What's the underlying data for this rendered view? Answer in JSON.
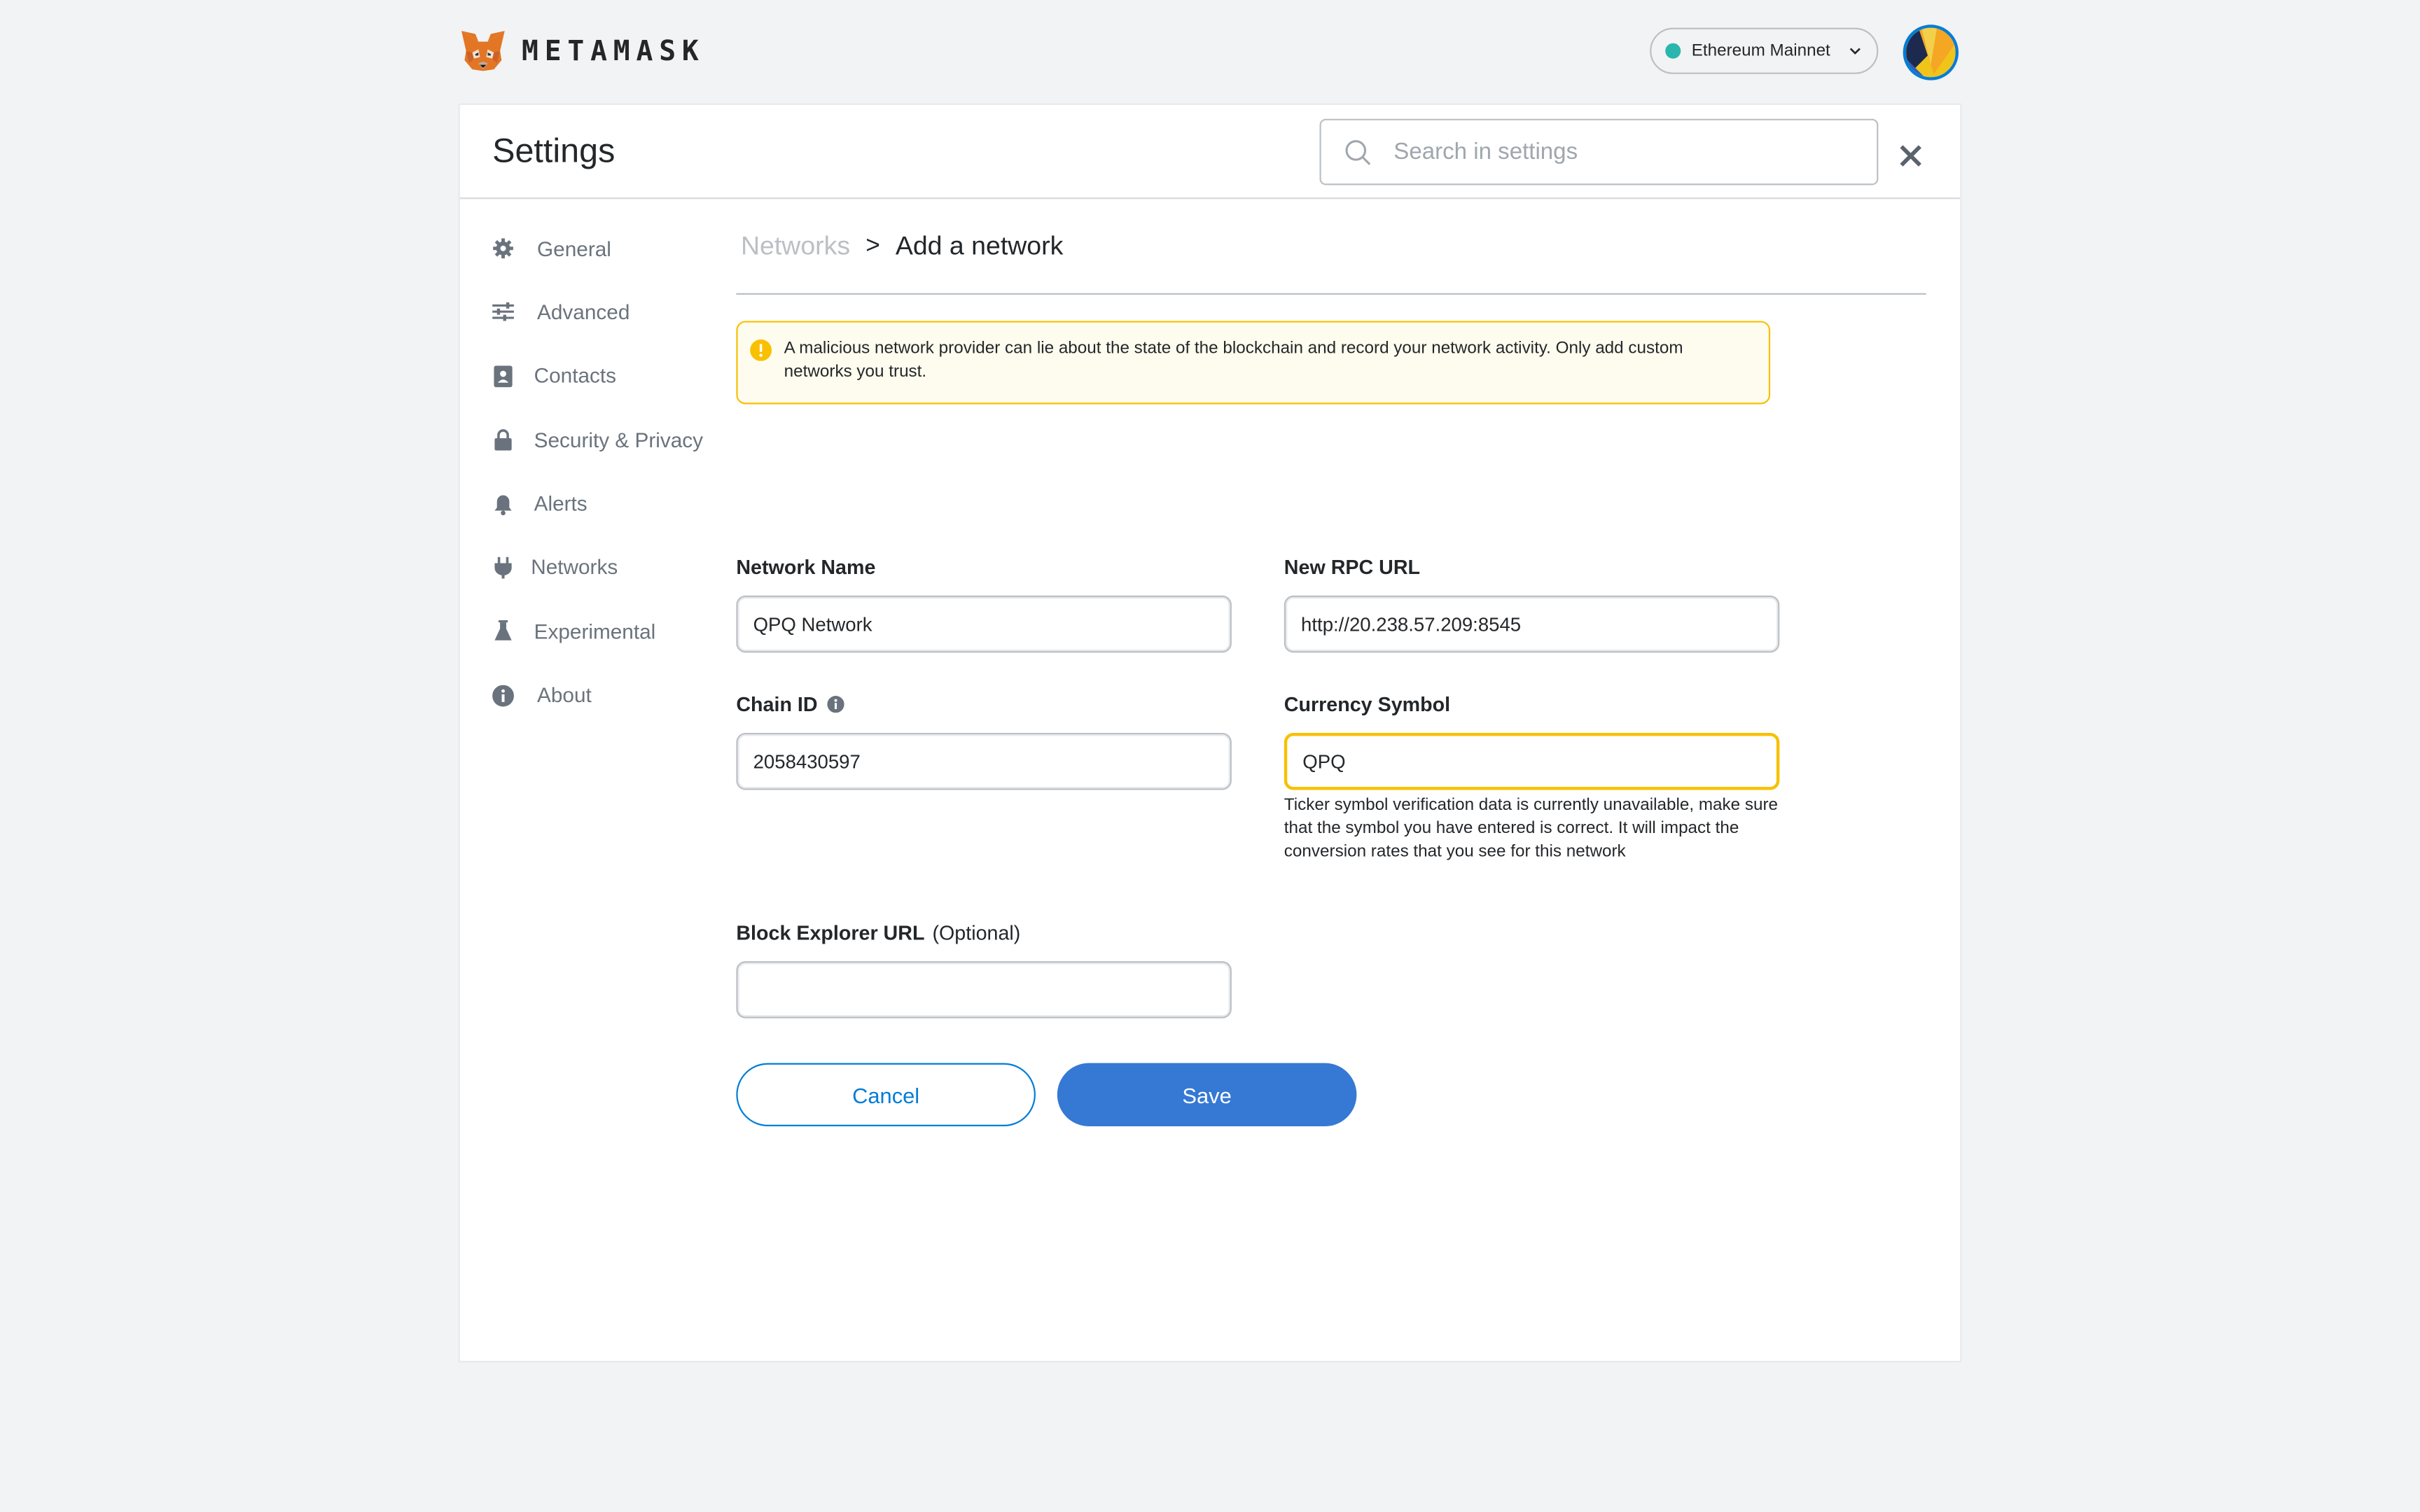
{
  "app": {
    "wordmark": "METAMASK",
    "network": "Ethereum Mainnet"
  },
  "header": {
    "title": "Settings",
    "search_placeholder": "Search in settings"
  },
  "sidebar": {
    "items": [
      {
        "label": "General",
        "icon": "gear-icon"
      },
      {
        "label": "Advanced",
        "icon": "sliders-icon"
      },
      {
        "label": "Contacts",
        "icon": "contact-book-icon"
      },
      {
        "label": "Security & Privacy",
        "icon": "lock-icon"
      },
      {
        "label": "Alerts",
        "icon": "bell-icon"
      },
      {
        "label": "Networks",
        "icon": "plug-icon"
      },
      {
        "label": "Experimental",
        "icon": "flask-icon"
      },
      {
        "label": "About",
        "icon": "info-icon"
      }
    ]
  },
  "breadcrumb": {
    "parent": "Networks",
    "separator": ">",
    "current": "Add a network"
  },
  "warning": {
    "text": "A malicious network provider can lie about the state of the blockchain and record your network activity. Only add custom networks you trust."
  },
  "form": {
    "network_name": {
      "label": "Network Name",
      "value": "QPQ Network"
    },
    "rpc_url": {
      "label": "New RPC URL",
      "value": "http://20.238.57.209:8545"
    },
    "chain_id": {
      "label": "Chain ID",
      "value": "2058430597"
    },
    "currency_symbol": {
      "label": "Currency Symbol",
      "value": "QPQ",
      "help": "Ticker symbol verification data is currently unavailable, make sure that the symbol you have entered is correct. It will impact the conversion rates that you see for this network"
    },
    "block_explorer": {
      "label": "Block Explorer URL",
      "optional": "(Optional)",
      "value": ""
    }
  },
  "buttons": {
    "cancel": "Cancel",
    "save": "Save"
  },
  "colors": {
    "accent": "#037dd6",
    "save_bg": "#3579d4",
    "warning_border": "#f8c000",
    "warning_bg": "#fefcee",
    "network_dot": "#29b6af"
  }
}
